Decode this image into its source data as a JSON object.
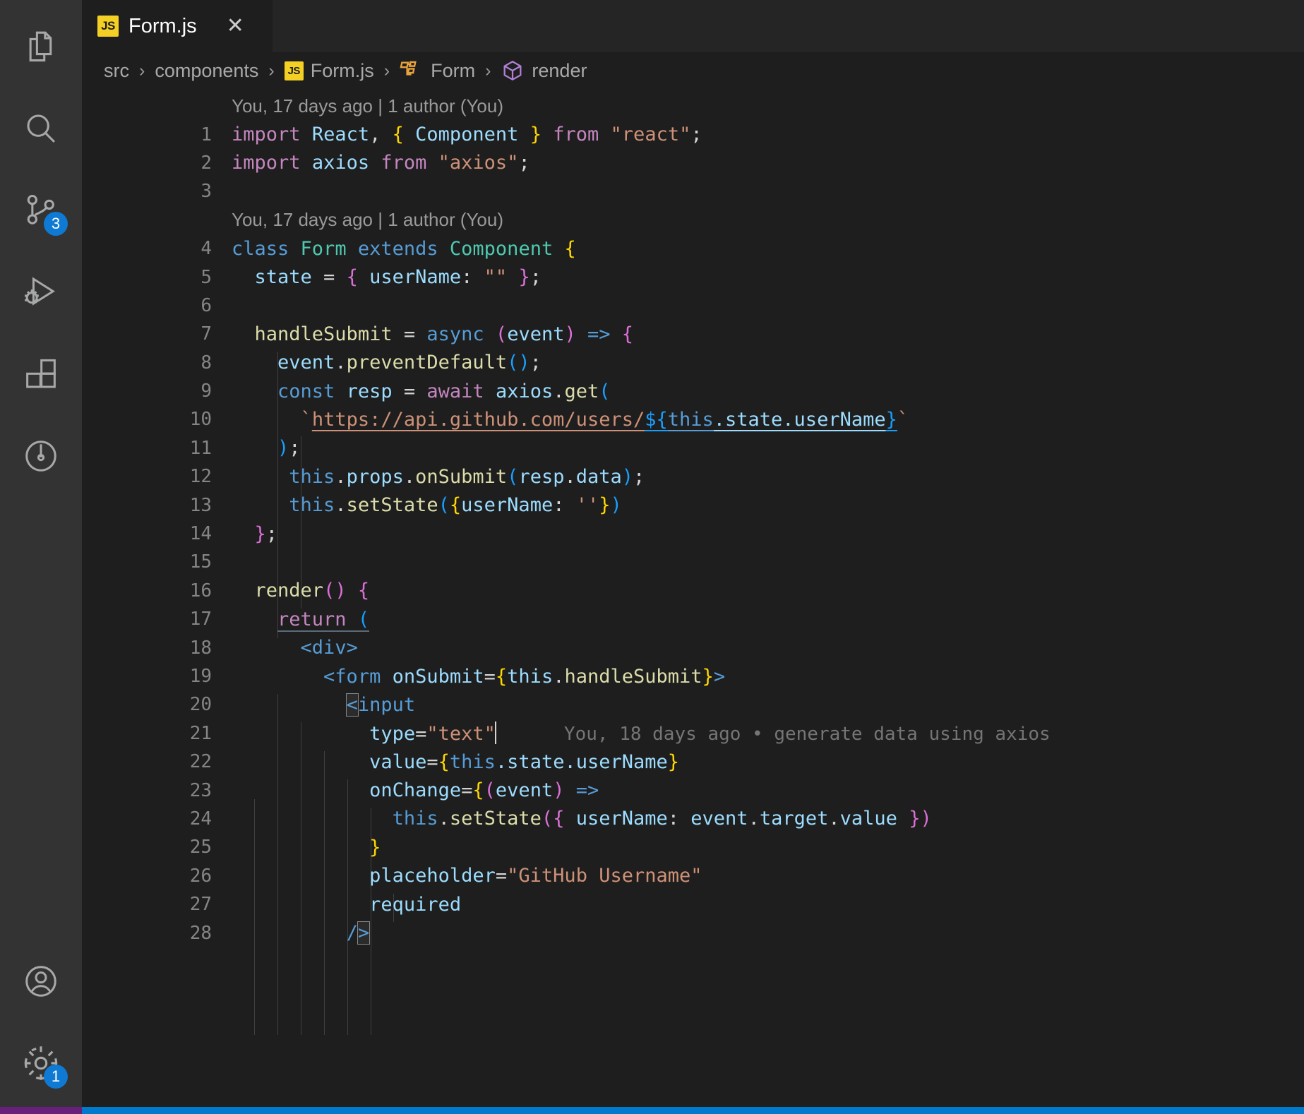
{
  "activity_bar": {
    "items": [
      {
        "name": "explorer",
        "icon": "files-icon",
        "badge": null
      },
      {
        "name": "search",
        "icon": "search-icon",
        "badge": null
      },
      {
        "name": "source-control",
        "icon": "source-control-icon",
        "badge": "3"
      },
      {
        "name": "run-and-debug",
        "icon": "run-debug-icon",
        "badge": null
      },
      {
        "name": "extensions",
        "icon": "extensions-icon",
        "badge": null
      },
      {
        "name": "testing",
        "icon": "testing-icon",
        "badge": null
      }
    ],
    "bottom_items": [
      {
        "name": "accounts",
        "icon": "account-icon",
        "badge": null
      },
      {
        "name": "manage-settings",
        "icon": "gear-icon",
        "badge": "1"
      }
    ]
  },
  "tab": {
    "file_badge": "JS",
    "label": "Form.js",
    "close": "✕"
  },
  "breadcrumbs": {
    "separator": "›",
    "items": [
      {
        "label": "src",
        "icon": null
      },
      {
        "label": "components",
        "icon": null
      },
      {
        "label": "Form.js",
        "icon": "js-file-icon"
      },
      {
        "label": "Form",
        "icon": "class-symbol-icon"
      },
      {
        "label": "render",
        "icon": "method-symbol-icon"
      }
    ]
  },
  "blame": {
    "heading_1": "You, 17 days ago | 1 author (You)",
    "heading_2": "You, 17 days ago | 1 author (You)",
    "inline": "You, 18 days ago • generate data using axios"
  },
  "code": {
    "line_numbers": [
      "1",
      "2",
      "3",
      "4",
      "5",
      "6",
      "7",
      "8",
      "9",
      "10",
      "11",
      "12",
      "13",
      "14",
      "15",
      "16",
      "17",
      "18",
      "19",
      "20",
      "21",
      "22",
      "23",
      "24",
      "25",
      "26",
      "27",
      "28"
    ],
    "lines": [
      "import React, { Component } from \"react\";",
      "import axios from \"axios\";",
      "",
      "class Form extends Component {",
      "  state = { userName: \"\" };",
      "",
      "  handleSubmit = async (event) => {",
      "    event.preventDefault();",
      "    const resp = await axios.get(",
      "      `https://api.github.com/users/${this.state.userName}`",
      "    );",
      "     this.props.onSubmit(resp.data);",
      "     this.setState({userName: ''})",
      "  };",
      "",
      "  render() {",
      "    return (",
      "      <div>",
      "        <form onSubmit={this.handleSubmit}>",
      "          <input",
      "            type=\"text\"",
      "            value={this.state.userName}",
      "            onChange={(event) =>",
      "              this.setState({ userName: event.target.value })",
      "            }",
      "            placeholder=\"GitHub Username\"",
      "            required",
      "          />"
    ]
  },
  "colors": {
    "editor_background": "#1e1e1e",
    "activitybar_background": "#333333",
    "tabbar_background": "#252526",
    "badge_background": "#0e7ad4",
    "js_icon": "#f5d024",
    "status_bar": "#007acc",
    "keyword_pink": "#c586c0",
    "keyword_blue": "#569cd6",
    "variable": "#9cdcfe",
    "type": "#4ec9b0",
    "function": "#dcdcaa",
    "string": "#ce9178",
    "line_number": "#858585",
    "blame_text": "#9a9a9a"
  }
}
